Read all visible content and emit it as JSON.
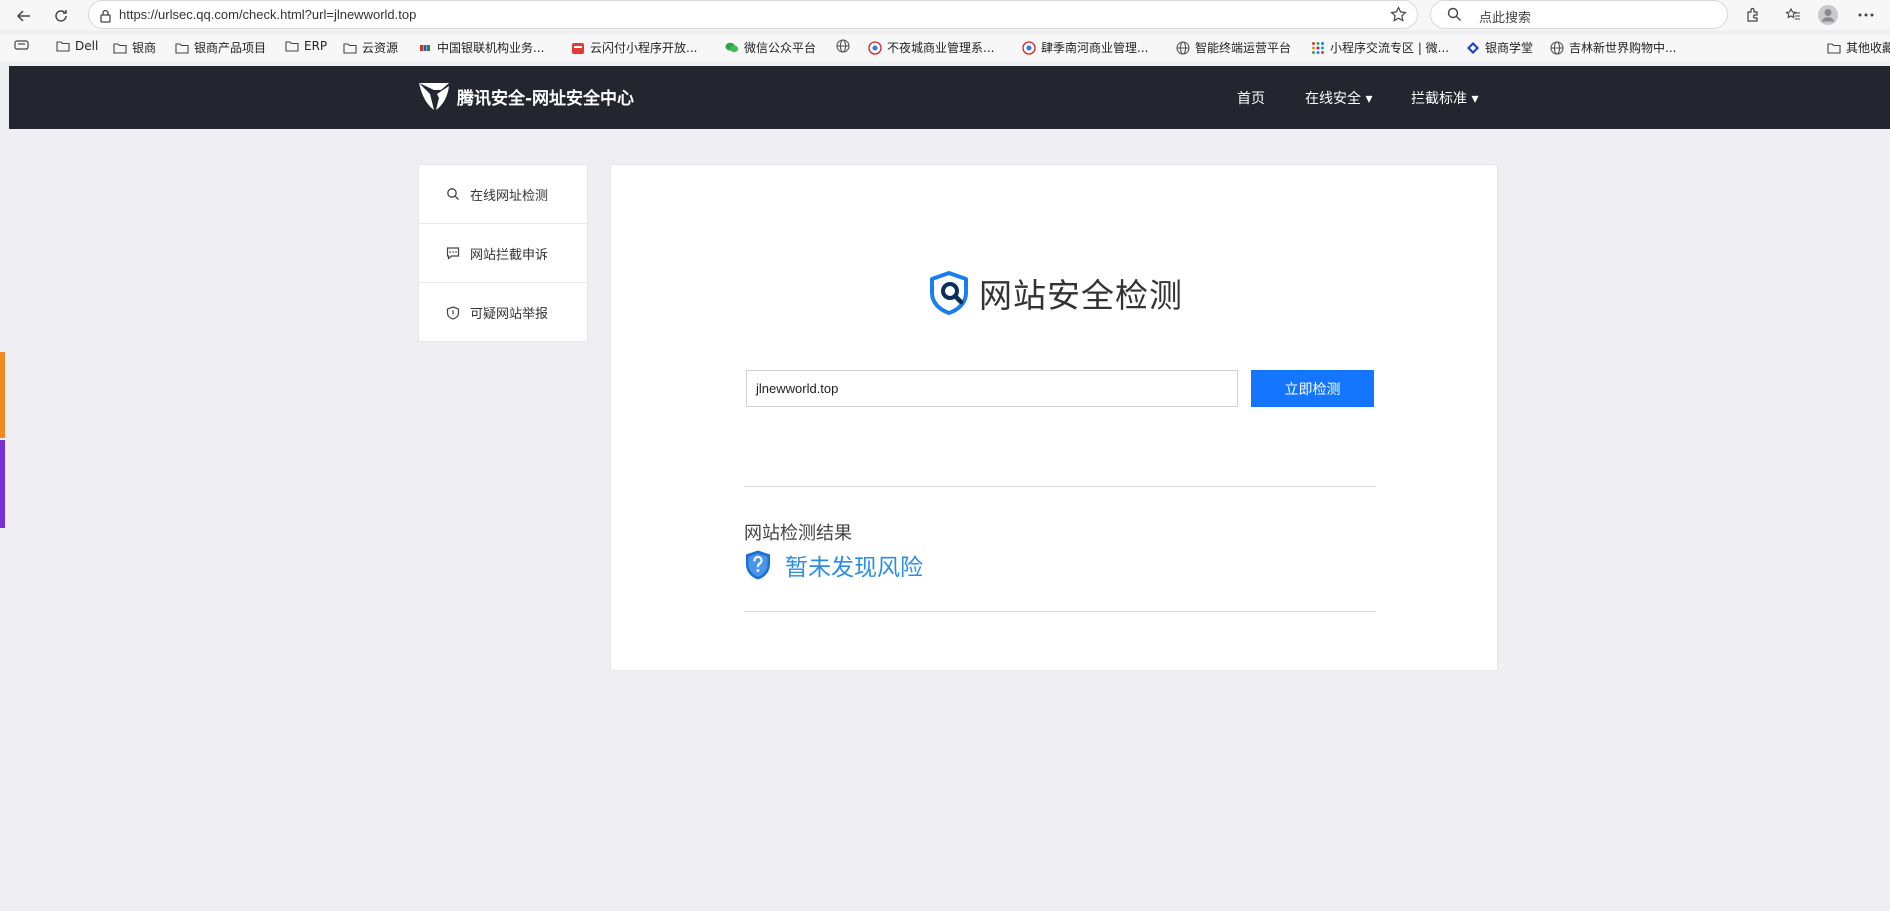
{
  "browser": {
    "url": "https://urlsec.qq.com/check.html?url=jlnewworld.top",
    "search_placeholder": "点此搜索"
  },
  "bookmarks": [
    {
      "label": "Dell",
      "icon": "folder-icon"
    },
    {
      "label": "银商",
      "icon": "folder-icon"
    },
    {
      "label": "银商产品项目",
      "icon": "folder-icon"
    },
    {
      "label": "ERP",
      "icon": "folder-icon"
    },
    {
      "label": "云资源",
      "icon": "folder-icon"
    },
    {
      "label": "中国银联机构业务...",
      "icon": "unionpay-icon"
    },
    {
      "label": "云闪付小程序开放...",
      "icon": "app-icon"
    },
    {
      "label": "微信公众平台",
      "icon": "wechat-icon"
    },
    {
      "label": "",
      "icon": "globe-icon"
    },
    {
      "label": "不夜城商业管理系...",
      "icon": "site-icon"
    },
    {
      "label": "肆季南河商业管理...",
      "icon": "site-icon"
    },
    {
      "label": "智能终端运营平台",
      "icon": "globe-icon"
    },
    {
      "label": "小程序交流专区 | 微...",
      "icon": "grid-icon"
    },
    {
      "label": "银商学堂",
      "icon": "diamond-icon"
    },
    {
      "label": "吉林新世界购物中...",
      "icon": "globe-icon"
    },
    {
      "label": "其他收藏",
      "icon": "folder-icon"
    }
  ],
  "site": {
    "logo_text": "腾讯安全-网址安全中心",
    "nav": [
      {
        "label": "首页"
      },
      {
        "label": "在线安全 ▾"
      },
      {
        "label": "拦截标准 ▾"
      }
    ]
  },
  "sidebar": {
    "items": [
      {
        "label": "在线网址检测"
      },
      {
        "label": "网站拦截申诉"
      },
      {
        "label": "可疑网站举报"
      }
    ]
  },
  "main": {
    "title": "网站安全检测",
    "input_value": "jlnewworld.top",
    "button_label": "立即检测",
    "result_label": "网站检测结果",
    "result_value": "暂未发现风险"
  },
  "colors": {
    "header_bg": "#23252f",
    "accent": "#1476fe",
    "result_blue": "#2a8de6"
  }
}
